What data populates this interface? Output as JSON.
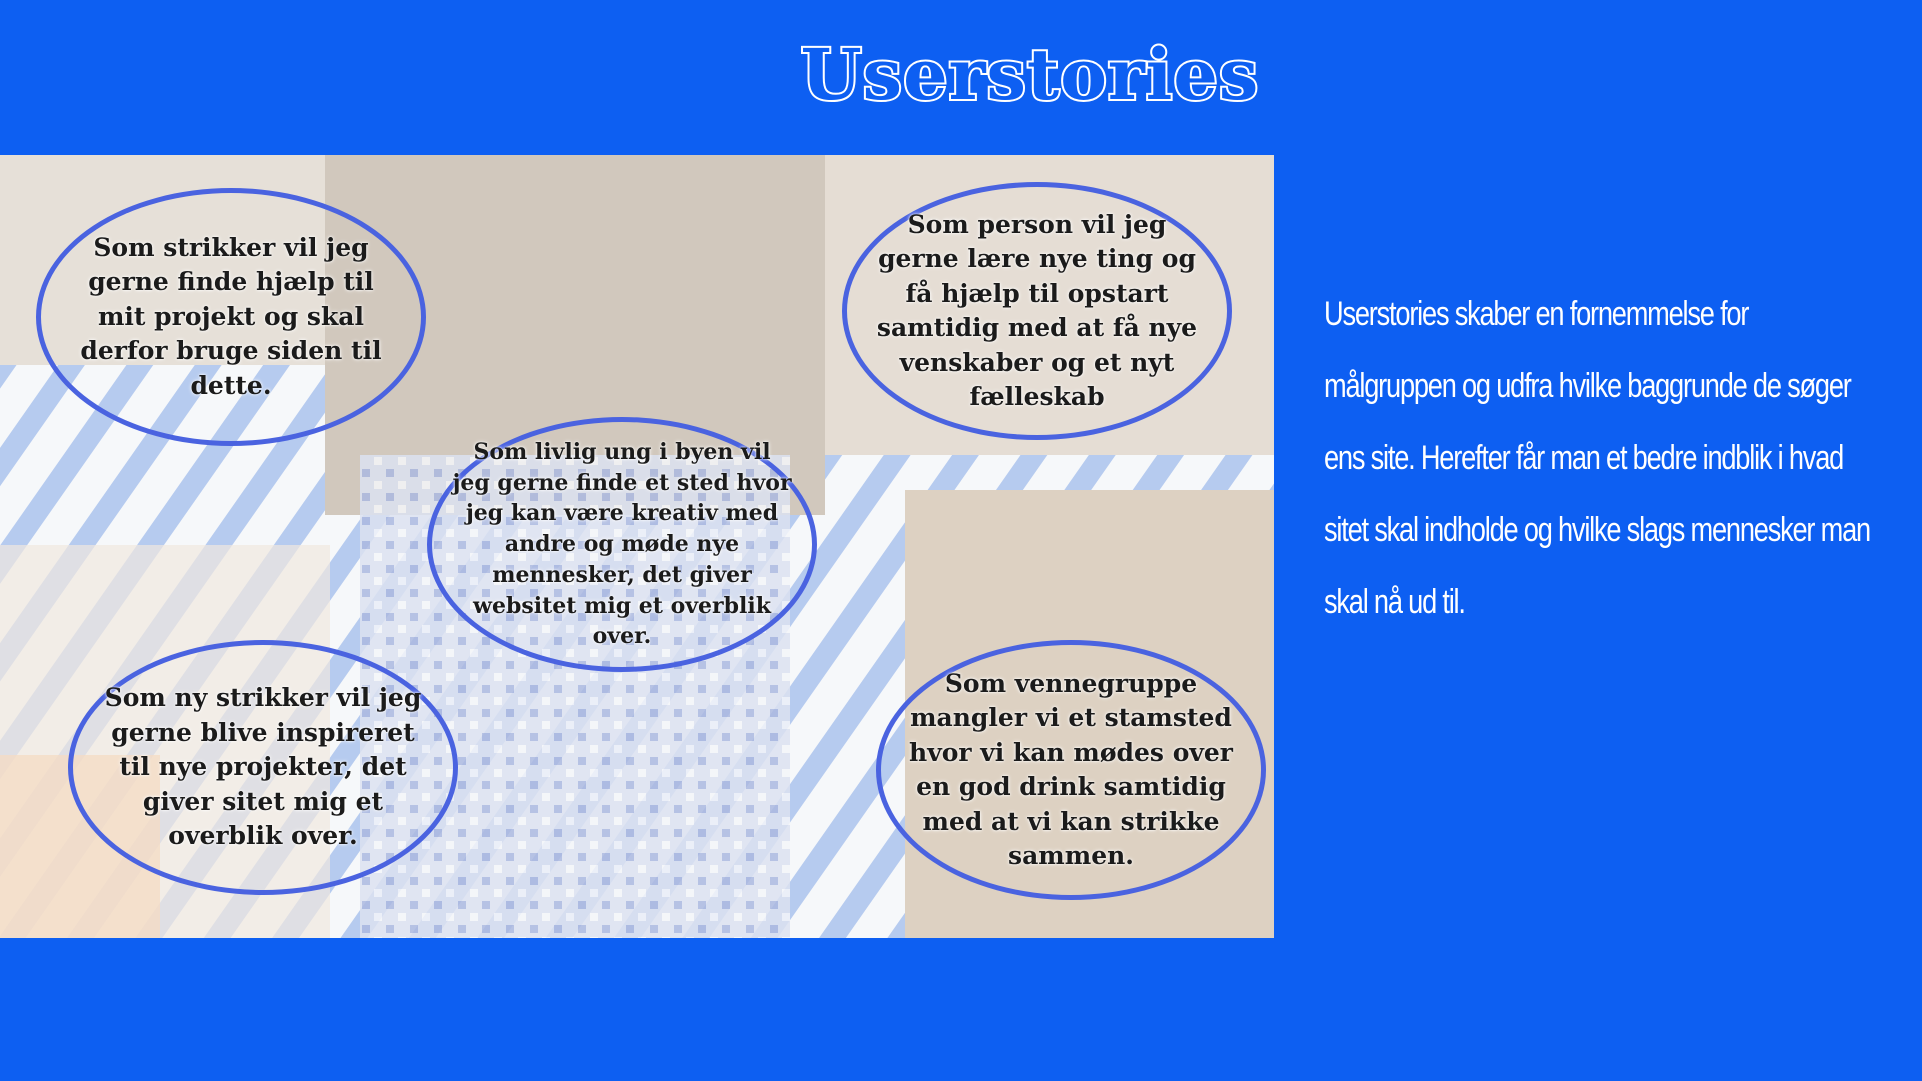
{
  "title": "Userstories",
  "colors": {
    "background": "#0d5ff2",
    "title_fill": "#0d5ff2",
    "title_outline": "#ffffff",
    "ellipse_border": "#4a63e0",
    "description_text": "#ffffff"
  },
  "stories": [
    {
      "text": "Som strikker vil jeg gerne finde hjælp til mit projekt og skal derfor bruge siden til dette."
    },
    {
      "text": "Som person vil jeg gerne lære nye ting og få hjælp til opstart samtidig med at få nye venskaber og et nyt fælleskab"
    },
    {
      "text": "Som livlig ung i byen vil jeg gerne finde et sted hvor jeg kan være kreativ med andre og møde nye mennesker, det giver websitet mig et overblik over."
    },
    {
      "text": "Som ny strikker vil jeg gerne blive inspireret til nye projekter, det giver sitet mig et overblik over."
    },
    {
      "text": "Som vennegruppe mangler vi et stamsted hvor vi kan mødes over en god drink samtidig med at vi kan strikke sammen."
    }
  ],
  "description": "Userstories skaber en fornemmelse for målgruppen  og udfra hvilke baggrunde de søger ens site. Herefter får man et bedre indblik i hvad sitet skal indholde og hvilke slags mennesker man skal nå ud til."
}
